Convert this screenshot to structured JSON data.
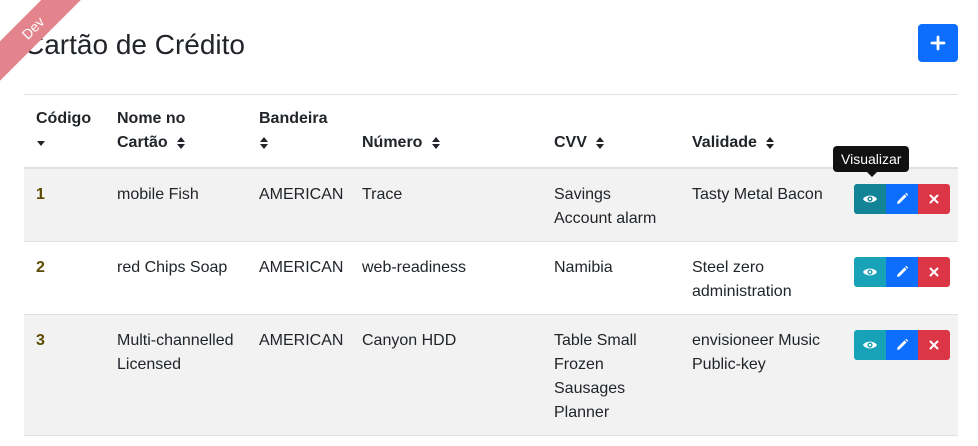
{
  "environment_badge": "Dev",
  "header": {
    "title": "Cartão de Crédito"
  },
  "table": {
    "columns": [
      {
        "label": "Código",
        "sort": "desc"
      },
      {
        "label": "Nome no Cartão",
        "sort": "both"
      },
      {
        "label": "Bandeira",
        "sort": "both"
      },
      {
        "label": "Número",
        "sort": "both"
      },
      {
        "label": "CVV",
        "sort": "both"
      },
      {
        "label": "Validade",
        "sort": "both"
      },
      {
        "label": "",
        "sort": "none"
      }
    ],
    "rows": [
      {
        "codigo": "1",
        "nome": "mobile Fish",
        "bandeira": "AMERICAN",
        "numero": "Trace",
        "cvv": "Savings Account alarm",
        "validade": "Tasty Metal Bacon"
      },
      {
        "codigo": "2",
        "nome": "red Chips Soap",
        "bandeira": "AMERICAN",
        "numero": "web-readiness",
        "cvv": "Namibia",
        "validade": "Steel zero administration"
      },
      {
        "codigo": "3",
        "nome": "Multi-channelled Licensed",
        "bandeira": "AMERICAN",
        "numero": "Canyon HDD",
        "cvv": "Table Small Frozen Sausages Planner",
        "validade": "envisioneer Music Public-key"
      }
    ]
  },
  "tooltip": {
    "text": "Visualizar"
  },
  "colors": {
    "primary": "#0d6efd",
    "info": "#17a2b8",
    "danger": "#dc3545",
    "ribbon": "#e3848c",
    "row_stripe": "#f2f2f2"
  },
  "icons": {
    "add": "plus-icon",
    "view": "eye-icon",
    "edit": "pencil-icon",
    "delete": "close-icon",
    "sort_both": "sort-icon",
    "sort_desc": "sort-down-icon"
  }
}
